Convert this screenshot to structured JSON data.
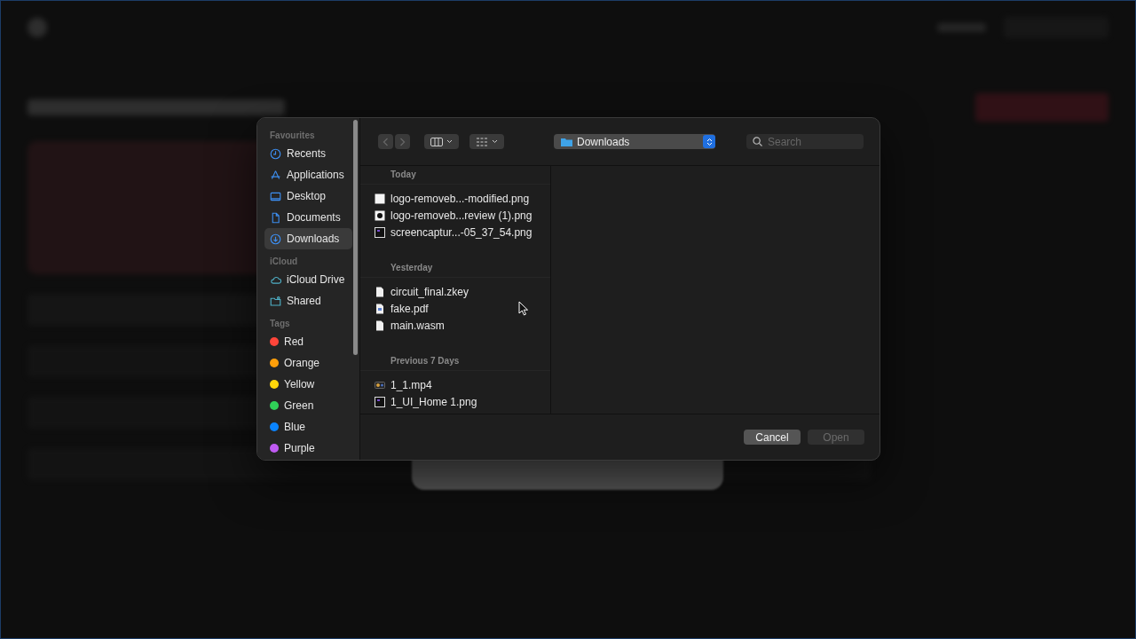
{
  "dialog": {
    "toolbar": {
      "location": "Downloads",
      "search": {
        "placeholder": "Search"
      }
    },
    "sidebar": [
      {
        "heading": "Favourites",
        "items": [
          {
            "label": "Recents",
            "kind": "clock",
            "selected": false
          },
          {
            "label": "Applications",
            "kind": "apps",
            "selected": false
          },
          {
            "label": "Desktop",
            "kind": "desktop",
            "selected": false
          },
          {
            "label": "Documents",
            "kind": "document",
            "selected": false
          },
          {
            "label": "Downloads",
            "kind": "download",
            "selected": true
          }
        ]
      },
      {
        "heading": "iCloud",
        "items": [
          {
            "label": "iCloud Drive",
            "kind": "cloud",
            "selected": false
          },
          {
            "label": "Shared",
            "kind": "shared",
            "selected": false
          }
        ]
      },
      {
        "heading": "Tags",
        "items": [
          {
            "label": "Red",
            "kind": "tag",
            "color": "#ff453a",
            "selected": false
          },
          {
            "label": "Orange",
            "kind": "tag",
            "color": "#ff9f0a",
            "selected": false
          },
          {
            "label": "Yellow",
            "kind": "tag",
            "color": "#ffd60a",
            "selected": false
          },
          {
            "label": "Green",
            "kind": "tag",
            "color": "#30d158",
            "selected": false
          },
          {
            "label": "Blue",
            "kind": "tag",
            "color": "#0a84ff",
            "selected": false
          },
          {
            "label": "Purple",
            "kind": "tag",
            "color": "#bf5af2",
            "selected": false
          }
        ]
      }
    ],
    "file_groups": [
      {
        "heading": "Today",
        "files": [
          {
            "name": "logo-removeb...-modified.png",
            "kind": "image"
          },
          {
            "name": "logo-removeb...review (1).png",
            "kind": "logo"
          },
          {
            "name": "screencaptur...-05_37_54.png",
            "kind": "screenshot"
          }
        ]
      },
      {
        "heading": "Yesterday",
        "files": [
          {
            "name": "circuit_final.zkey",
            "kind": "document"
          },
          {
            "name": "fake.pdf",
            "kind": "pdf"
          },
          {
            "name": "main.wasm",
            "kind": "document"
          }
        ]
      },
      {
        "heading": "Previous 7 Days",
        "files": [
          {
            "name": "1_1.mp4",
            "kind": "video"
          },
          {
            "name": "1_UI_Home 1.png",
            "kind": "screenshot"
          }
        ]
      }
    ],
    "buttons": [
      {
        "label": "Cancel",
        "disabled": false
      },
      {
        "label": "Open",
        "disabled": true
      }
    ]
  }
}
